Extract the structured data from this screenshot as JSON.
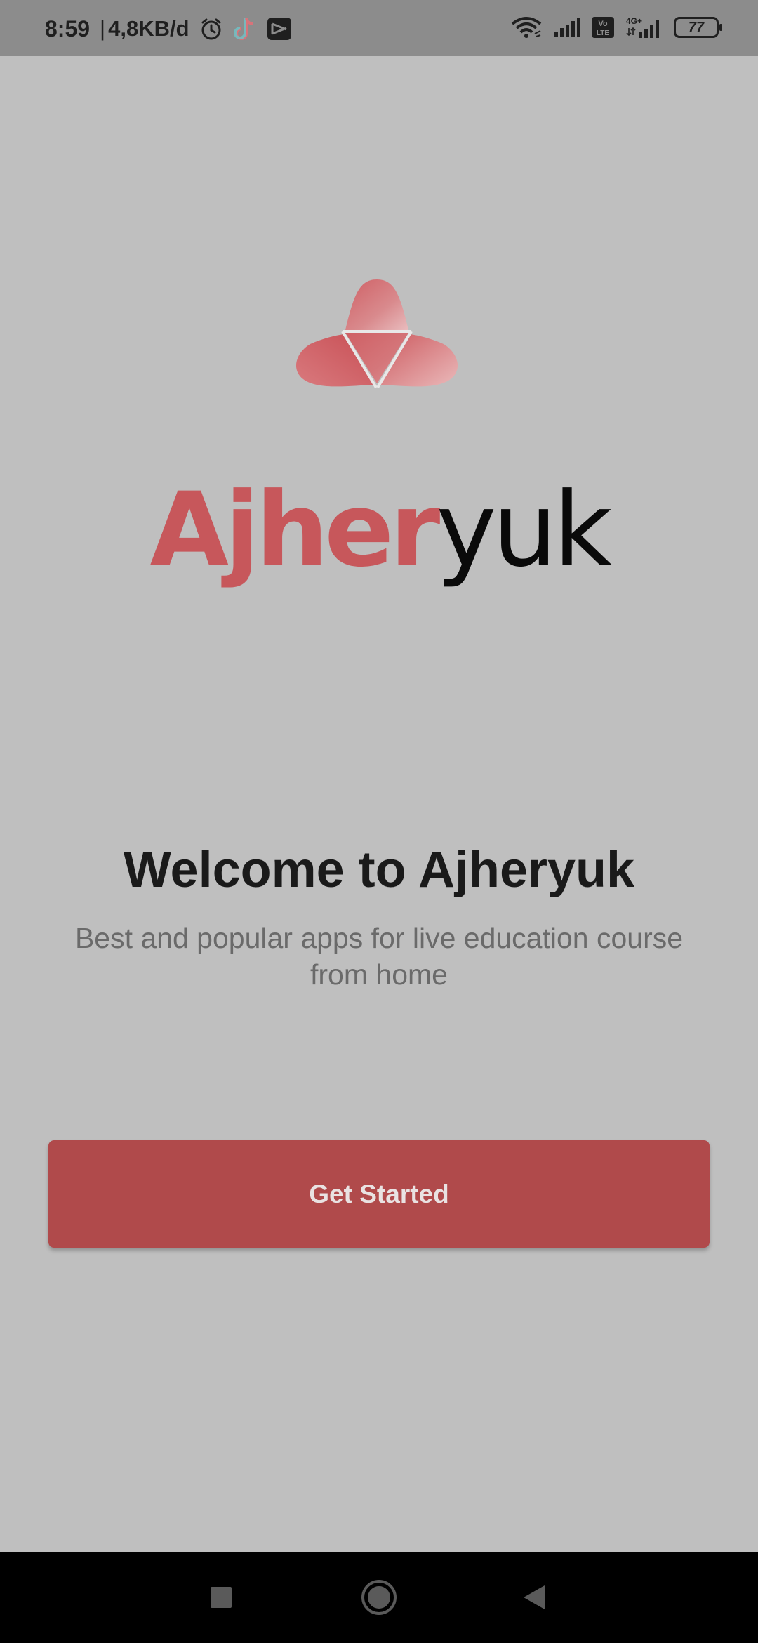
{
  "status_bar": {
    "time": "8:59",
    "separator": "|",
    "network_speed": "4,8KB/d",
    "icons_left": [
      "alarm-icon",
      "tiktok-icon",
      "capcut-icon"
    ],
    "icons_right": [
      "wifi-icon",
      "signal-icon",
      "volte-icon",
      "4g-signal-icon",
      "battery-icon"
    ],
    "volte_label": "Vo LTE",
    "network_type": "4G+",
    "battery_level": "77"
  },
  "brand": {
    "name_part_red": "Ajher",
    "name_part_black": "yuk",
    "logo_icon": "triangle-logo-icon",
    "accent_color": "#c7575b"
  },
  "welcome": {
    "title": "Welcome to Ajheryuk",
    "subtitle": "Best and popular apps for live education course from home"
  },
  "cta": {
    "label": "Get Started",
    "color": "#b04a4b"
  },
  "navigation_bar": {
    "buttons": [
      "recents-square-icon",
      "home-circle-icon",
      "back-triangle-icon"
    ]
  }
}
